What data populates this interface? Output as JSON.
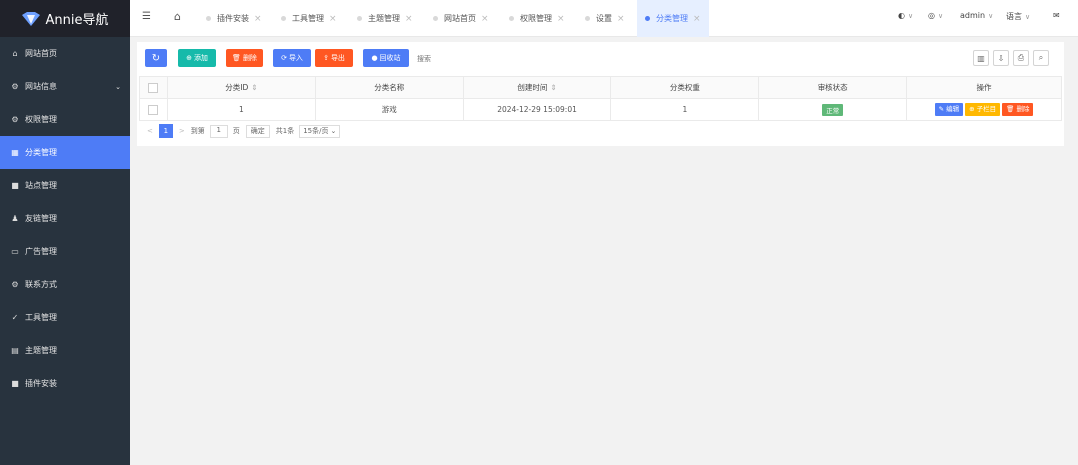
{
  "app": {
    "logo_text": "Annie导航"
  },
  "sidebar": {
    "items": [
      {
        "label": "网站首页",
        "icon": "home-icon",
        "glyph": "⌂"
      },
      {
        "label": "网站信息",
        "icon": "gear-icon",
        "glyph": "⚙",
        "expandable": true
      },
      {
        "label": "权限管理",
        "icon": "settings-icon",
        "glyph": "⚙"
      },
      {
        "label": "分类管理",
        "icon": "category-icon",
        "glyph": "▦",
        "active": true
      },
      {
        "label": "站点管理",
        "icon": "square-icon",
        "glyph": "■"
      },
      {
        "label": "友链管理",
        "icon": "users-icon",
        "glyph": "♟"
      },
      {
        "label": "广告管理",
        "icon": "image-icon",
        "glyph": "▭"
      },
      {
        "label": "联系方式",
        "icon": "gear-icon",
        "glyph": "⚙"
      },
      {
        "label": "工具管理",
        "icon": "check-circle-icon",
        "glyph": "✓"
      },
      {
        "label": "主题管理",
        "icon": "window-icon",
        "glyph": "▤"
      },
      {
        "label": "插件安装",
        "icon": "square-icon",
        "glyph": "■"
      }
    ]
  },
  "header": {
    "menu_glyph": "☰",
    "home_glyph": "⌂",
    "close_glyph": "×",
    "tabs": [
      {
        "label": "插件安装"
      },
      {
        "label": "工具管理"
      },
      {
        "label": "主题管理"
      },
      {
        "label": "网站首页"
      },
      {
        "label": "权限管理"
      },
      {
        "label": "设置"
      },
      {
        "label": "分类管理",
        "active": true
      }
    ],
    "right": {
      "theme_glyph": "◐",
      "globe_glyph": "◎",
      "user": "admin",
      "language": "语言",
      "message_glyph": "✉",
      "caret": "∨"
    }
  },
  "toolbar": {
    "refresh_glyph": "↻",
    "add": {
      "label": "添加",
      "glyph": "⊕",
      "color": "#16baaa"
    },
    "delete": {
      "label": "删除",
      "glyph": "🗑",
      "color": "#ff5722"
    },
    "import": {
      "label": "导入",
      "glyph": "⟳",
      "color": "#4e7cf6"
    },
    "export": {
      "label": "导出",
      "glyph": "⇪",
      "color": "#ff5722"
    },
    "recycle": {
      "label": "回收站",
      "glyph": "●",
      "color": "#4e7cf6"
    },
    "search_placeholder": "搜索",
    "right_glyphs": [
      "▥",
      "⇩",
      "⎙",
      "⌕"
    ]
  },
  "table": {
    "headers": [
      "分类ID",
      "分类名称",
      "创建时间",
      "分类权重",
      "审核状态",
      "操作"
    ],
    "sort_glyph": "⇕",
    "rows": [
      {
        "id": "1",
        "name": "游戏",
        "created": "2024-12-29 15:09:01",
        "weight": "1",
        "status": "正常",
        "actions": {
          "edit": "编辑",
          "sub": "子栏目",
          "del": "删除"
        }
      }
    ]
  },
  "pagination": {
    "prev": "<",
    "current_page": "1",
    "next": ">",
    "goto_label": "到第",
    "page_input": "1",
    "page_unit": "页",
    "confirm": "确定",
    "total": "共1条",
    "per_page": "15条/页",
    "per_page_caret": "⌄"
  },
  "colors": {
    "accent": "#4e7cf6",
    "sidebar_bg": "#28333e",
    "logo_bg": "#20222a",
    "status_green": "#5fb878",
    "edit_blue": "#4e7cf6",
    "sub_orange": "#ffb800",
    "delete_red": "#ff5722"
  }
}
